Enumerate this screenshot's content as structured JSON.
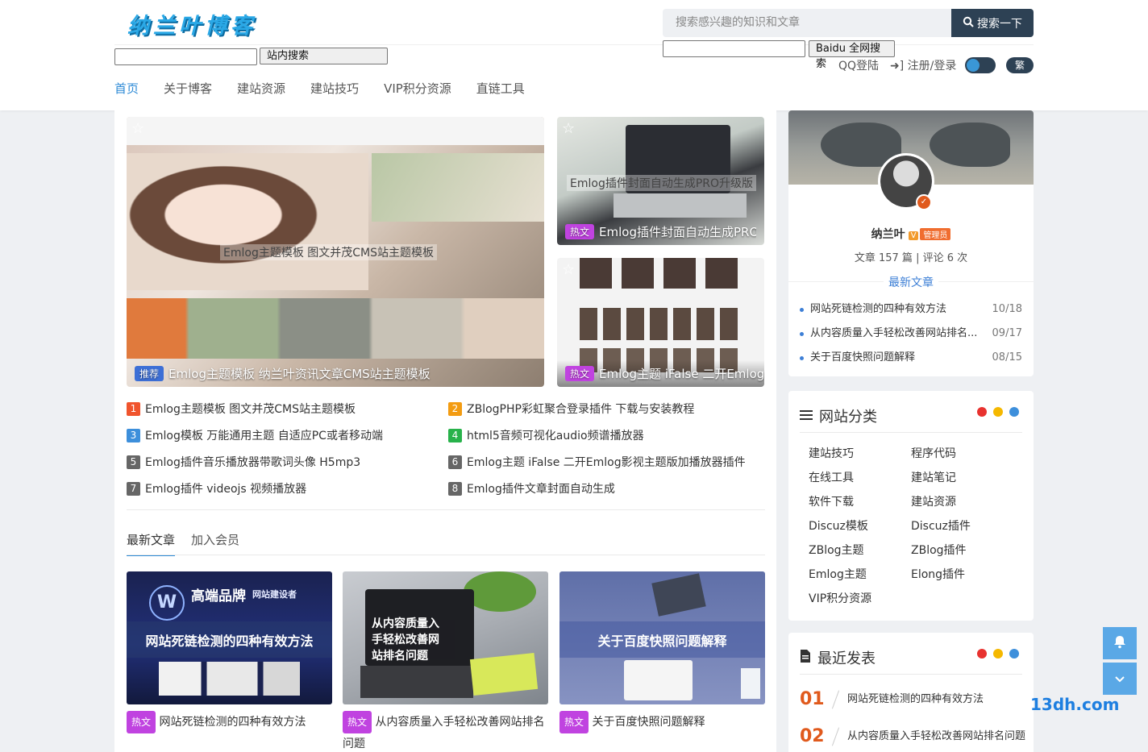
{
  "header": {
    "logo": "纳兰叶博客",
    "search_placeholder": "搜索感兴趣的知识和文章",
    "search_button": "搜索一下",
    "site_search_button": "站内搜索",
    "baidu_button": "Baidu 全网搜索",
    "qq_login": "QQ登陆",
    "register_login": "注册/登录",
    "traditional": "繁"
  },
  "nav": [
    "首页",
    "关于博客",
    "建站资源",
    "建站技巧",
    "VIP积分资源",
    "直链工具"
  ],
  "featured": {
    "main": {
      "tag": "推荐",
      "title": "Emlog主题模板 纳兰叶资讯文章CMS站主题模板",
      "watermark": "Emlog主题模板 图文并茂CMS站主题模板"
    },
    "top_right": {
      "tag": "热文",
      "title": "Emlog插件封面自动生成PRO...",
      "watermark": "Emlog插件封面自动生成PRO升级版"
    },
    "bottom_right": {
      "tag": "热文",
      "title": "Emlog主题 iFalse 二开Emlog..."
    }
  },
  "ranks": [
    {
      "n": "1",
      "title": "Emlog主题模板 图文并茂CMS站主题模板",
      "color": "#f0542d"
    },
    {
      "n": "2",
      "title": "ZBlogPHP彩虹聚合登录插件 下载与安装教程",
      "color": "#f39c12"
    },
    {
      "n": "3",
      "title": "Emlog模板 万能通用主题 自适应PC或者移动端",
      "color": "#3d8fdb"
    },
    {
      "n": "4",
      "title": "html5音频可视化audio频谱播放器",
      "color": "#28b24b"
    },
    {
      "n": "5",
      "title": "Emlog插件音乐播放器带歌词头像 H5mp3",
      "color": "#666666"
    },
    {
      "n": "6",
      "title": "Emlog主题 iFalse 二开Emlog影视主题版加播放器插件",
      "color": "#666666"
    },
    {
      "n": "7",
      "title": "Emlog插件 videojs 视频播放器",
      "color": "#666666"
    },
    {
      "n": "8",
      "title": "Emlog插件文章封面自动生成",
      "color": "#666666"
    }
  ],
  "tabs": [
    "最新文章",
    "加入会员"
  ],
  "posts": [
    {
      "overlay": "网站死链检测的四种有效方法",
      "tag": "热文",
      "title": "网站死链检测的四种有效方法",
      "brand": "高端品牌",
      "brand_sub": "网站建设者"
    },
    {
      "overlay": "从内容质量入手轻松改善网站排名问题",
      "tag": "热文",
      "title": "从内容质量入手轻松改善网站排名问题"
    },
    {
      "overlay": "关于百度快照问题解释",
      "tag": "热文",
      "title": "关于百度快照问题解释"
    }
  ],
  "profile": {
    "name": "纳兰叶",
    "v": "V",
    "role": "管理员",
    "stats": "文章 157 篇 | 评论 6 次",
    "latest_link": "最新文章",
    "items": [
      {
        "title": "网站死链检测的四种有效方法",
        "date": "10/18"
      },
      {
        "title": "从内容质量入手轻松改善网站排名...",
        "date": "09/17"
      },
      {
        "title": "关于百度快照问题解释",
        "date": "08/15"
      }
    ]
  },
  "categories": {
    "title": "网站分类",
    "items": [
      "建站技巧",
      "程序代码",
      "在线工具",
      "建站笔记",
      "软件下载",
      "建站资源",
      "Discuz模板",
      "Discuz插件",
      "ZBlog主题",
      "ZBlog插件",
      "Emlog主题",
      "Elong插件",
      "VIP积分资源"
    ]
  },
  "recent": {
    "title": "最近发表",
    "items": [
      {
        "n": "01",
        "title": "网站死链检测的四种有效方法"
      },
      {
        "n": "02",
        "title": "从内容质量入手轻松改善网站排名问题"
      }
    ]
  },
  "dot_colors": [
    "#e8322f",
    "#f5b800",
    "#3d8fdb"
  ],
  "watermark_brand": "13dh.com"
}
